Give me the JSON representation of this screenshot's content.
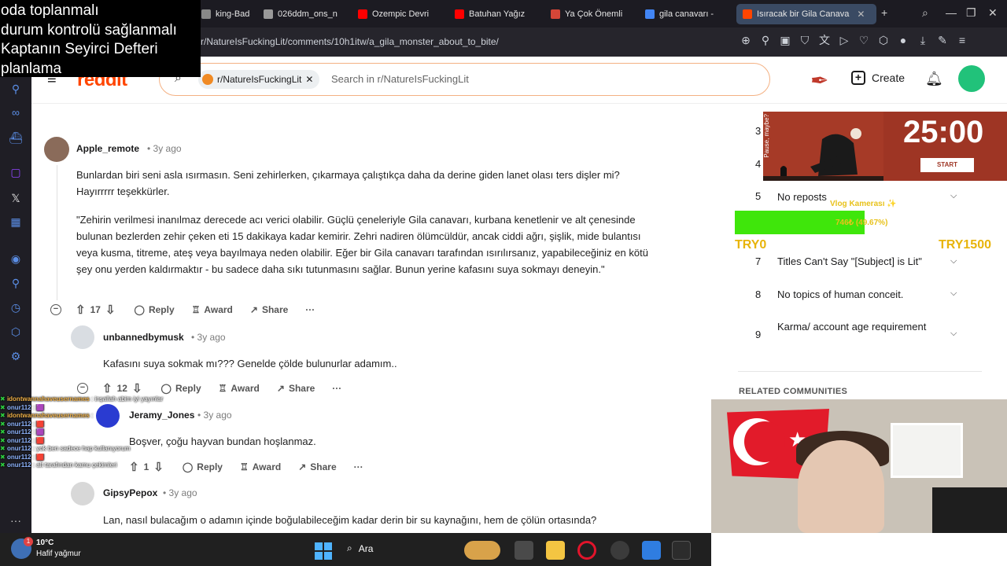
{
  "overlay_notes": [
    "oda toplanmalı",
    "durum kontrolü sağlanmalı",
    "Kaptanın Seyirci Defteri",
    "planlama"
  ],
  "tabs": [
    {
      "label": "king-Bad-",
      "fav_color": "#888"
    },
    {
      "label": "026ddm_ons_n",
      "fav_color": "#999"
    },
    {
      "label": "Ozempic Devri",
      "fav_color": "#ff0000"
    },
    {
      "label": "Batuhan Yağız",
      "fav_color": "#ff0000"
    },
    {
      "label": "Ya Çok Önemli",
      "fav_color": "#d44638"
    },
    {
      "label": "gila canavarı -",
      "fav_color": "#4285f4"
    },
    {
      "label": "Isıracak bir Gila Canava",
      "fav_color": "#ff4500"
    }
  ],
  "url": "r/NatureIsFuckingLit/comments/10h1itw/a_gila_monster_about_to_bite/",
  "header": {
    "logo": "reddit",
    "chip_label": "r/NatureIsFuckingLit",
    "search_placeholder": "Search in r/NatureIsFuckingLit",
    "create_label": "Create"
  },
  "comments": [
    {
      "user": "Apple_remote",
      "time": "3y ago",
      "text1": "Bunlardan biri seni asla ısırmasın. Seni zehirlerken, çıkarmaya çalıştıkça daha da derine giden lanet olası ters dişler mi? Hayırrrrr teşekkürler.",
      "text2": "\"Zehirin verilmesi inanılmaz derecede acı verici olabilir. Güçlü çeneleriyle Gila canavarı, kurbana kenetlenir ve alt çenesinde bulunan bezlerden zehir çeken eti 15 dakikaya kadar kemirir. Zehri nadiren ölümcüldür, ancak ciddi ağrı, şişlik, mide bulantısı veya kusma, titreme, ateş veya bayılmaya neden olabilir. Eğer bir Gila canavarı tarafından ısırılırsanız, yapabileceğiniz en kötü şey onu yerden kaldırmaktır - bu sadece daha sıkı tutunmasını sağlar. Bunun yerine kafasını suya sokmayı deneyin.\"",
      "votes": "17"
    },
    {
      "user": "unbannedbymusk",
      "time": "3y ago",
      "text": "Kafasını suya sokmak mı??? Genelde çölde bulunurlar adamım..",
      "votes": "12"
    },
    {
      "user": "Jeramy_Jones",
      "time": "3y ago",
      "text": "Boşver, çoğu hayvan bundan hoşlanmaz.",
      "votes": "1"
    },
    {
      "user": "GipsyPepox",
      "time": "3y ago",
      "text": "Lan, nasıl bulacağım o adamın içinde boğulabileceğim kadar derin bir su kaynağını, hem de çölün ortasında?"
    }
  ],
  "actions": {
    "reply": "Reply",
    "award": "Award",
    "share": "Share",
    "more": "···"
  },
  "rules": [
    {
      "num": "3",
      "text": ""
    },
    {
      "num": "4",
      "text": ""
    },
    {
      "num": "5",
      "text": "No reposts"
    },
    {
      "num": "7",
      "text": "Titles Can't Say \"[Subject] is Lit\""
    },
    {
      "num": "8",
      "text": "No topics of human conceit."
    },
    {
      "num": "9",
      "text": "Karma/ account age requirement"
    }
  ],
  "related_label": "RELATED COMMUNITIES",
  "pomodoro": {
    "time": "25:00",
    "start": "START",
    "caption": "Pause, maybe?"
  },
  "vlog": {
    "label": "Vlog Kamerası ✨",
    "progress_text": "746₺ (49.67%)",
    "progress_fraction": 0.4967,
    "min_label": "TRY0",
    "max_label": "TRY1500"
  },
  "chat": [
    {
      "name": "idontwannahaveusernames",
      "msg": "inşallah abim iyi yayınlar",
      "c": "chat-name"
    },
    {
      "name": "onur112",
      "msg": "🟪",
      "c": "chat-name2"
    },
    {
      "name": "idontwannahaveusernames",
      "msg": "",
      "c": "chat-name"
    },
    {
      "name": "onur112",
      "msg": "🟥",
      "c": "chat-name2"
    },
    {
      "name": "onur112",
      "msg": "🟪",
      "c": "chat-name2"
    },
    {
      "name": "onur112",
      "msg": "🟥",
      "c": "chat-name2"
    },
    {
      "name": "onur112",
      "msg": "yok ben sadece hap kullanıyorum",
      "c": "chat-name2"
    },
    {
      "name": "onur112",
      "msg": "🟥",
      "c": "chat-name2"
    },
    {
      "name": "onur112",
      "msg": "alt tarafından kamu çekimleri",
      "c": "chat-name2"
    }
  ],
  "taskbar": {
    "temp": "10°C",
    "weather": "Hafif yağmur",
    "badge": "1",
    "search": "Ara"
  }
}
